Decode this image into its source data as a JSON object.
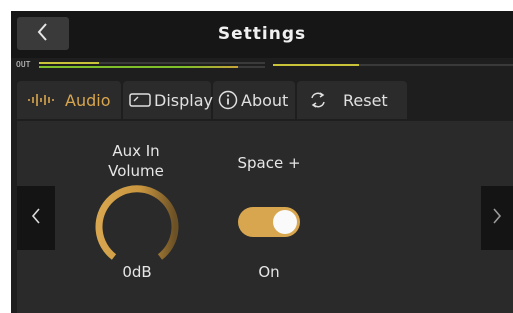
{
  "header": {
    "title": "Settings",
    "back_icon": "chevron-left-icon"
  },
  "meter": {
    "label": "OUT",
    "left_level": 0.88,
    "right_level": 0.36
  },
  "tabs": [
    {
      "label": "Audio",
      "icon": "audio-waveform-icon",
      "active": true
    },
    {
      "label": "Display",
      "icon": "display-icon",
      "active": false
    },
    {
      "label": "About",
      "icon": "info-icon",
      "active": false
    },
    {
      "label": "Reset",
      "icon": "reset-icon",
      "active": false
    }
  ],
  "controls": {
    "aux_in": {
      "label_line1": "Aux In",
      "label_line2": "Volume",
      "value": "0dB"
    },
    "space": {
      "label": "Space +",
      "state": "On"
    }
  },
  "nav": {
    "prev_icon": "chevron-left-icon",
    "next_icon": "chevron-right-icon"
  },
  "colors": {
    "accent": "#d8a64e",
    "meter_green": "#7fbf2a",
    "meter_yellow": "#c9c33a"
  }
}
